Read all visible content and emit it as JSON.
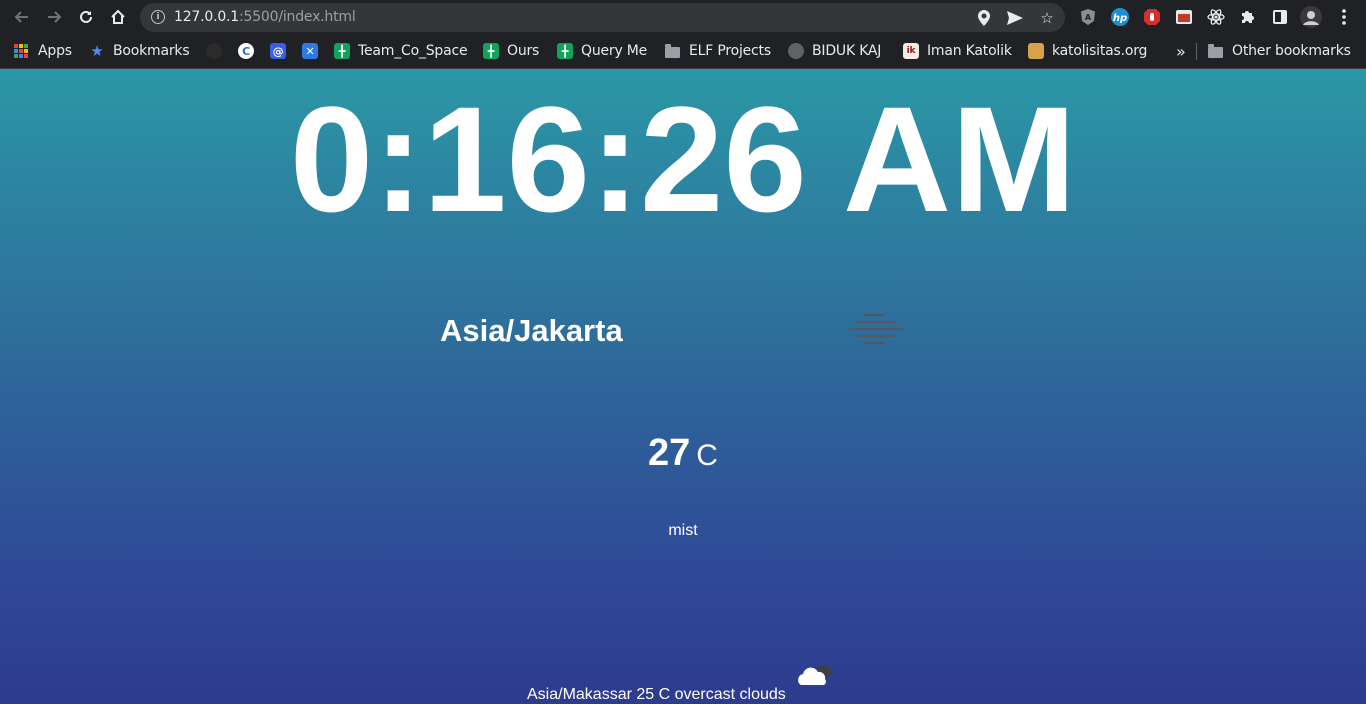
{
  "browser": {
    "url_host": "127.0.0.1",
    "url_path": ":5500/index.html",
    "bookmarks": [
      {
        "label": "Apps",
        "icon": "apps-grid-icon"
      },
      {
        "label": "Bookmarks",
        "icon": "star-icon"
      },
      {
        "label": "",
        "icon": "github-icon"
      },
      {
        "label": "",
        "icon": "codepen-icon"
      },
      {
        "label": "",
        "icon": "at-sign-icon"
      },
      {
        "label": "",
        "icon": "confluence-icon"
      },
      {
        "label": "Team_Co_Space",
        "icon": "sheets-icon"
      },
      {
        "label": "Ours",
        "icon": "sheets-icon"
      },
      {
        "label": "Query Me",
        "icon": "sheets-icon"
      },
      {
        "label": "ELF Projects",
        "icon": "folder-icon"
      },
      {
        "label": "BIDUK KAJ",
        "icon": "globe-icon"
      },
      {
        "label": "Iman Katolik",
        "icon": "ik-logo-icon"
      },
      {
        "label": "katolisitas.org",
        "icon": "katolisitas-icon"
      }
    ],
    "overflow_label": "»",
    "other_bookmarks": "Other bookmarks"
  },
  "clock": {
    "time": "0:16:26 AM"
  },
  "weather": {
    "city": "Asia/Jakarta",
    "temperature": "27",
    "unit": "C",
    "description": "mist",
    "icon": "mist-icon"
  },
  "secondary_weather": {
    "summary": "Asia/Makassar 25 C overcast clouds",
    "icon": "cloud-icon"
  },
  "colors": {
    "gradient_top": "#2b97a6",
    "gradient_bottom": "#2e3b8f",
    "browser_bg": "#202124"
  }
}
